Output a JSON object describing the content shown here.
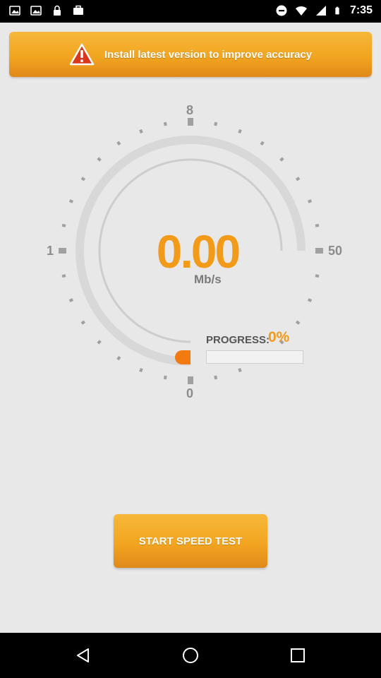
{
  "status_bar": {
    "time": "7:35",
    "icons": [
      "image-icon",
      "image-icon",
      "lock-icon",
      "briefcase-icon",
      "do-not-disturb-icon",
      "wifi-icon",
      "signal-icon",
      "battery-icon"
    ]
  },
  "banner": {
    "icon": "warning-icon",
    "text": "Install latest version to improve accuracy"
  },
  "gauge": {
    "label_top": "8",
    "label_left": "1",
    "label_right": "50",
    "label_bottom": "0",
    "speed_value": "0.00",
    "speed_unit": "Mb/s"
  },
  "progress": {
    "label": "PROGRESS:",
    "value_text": "0%",
    "fraction": 0
  },
  "start_button": {
    "label": "START SPEED TEST"
  },
  "nav_bar": {
    "icons": [
      "back-icon",
      "home-icon",
      "recents-icon"
    ]
  },
  "colors": {
    "accent": "#f29a1a",
    "background": "#e8e8e8",
    "gauge_track": "#d9d9d9"
  }
}
